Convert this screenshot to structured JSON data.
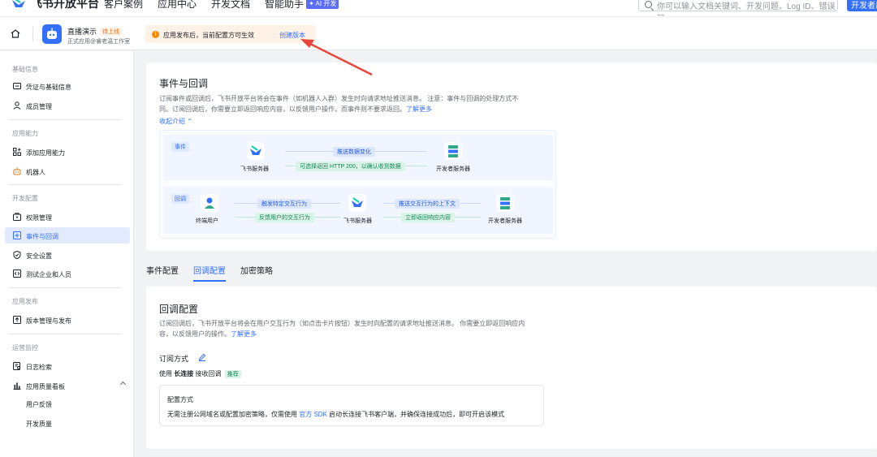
{
  "topnav": {
    "brand": "飞书开放平台",
    "items": [
      "客户案例",
      "应用中心",
      "开发文档",
      "智能助手"
    ],
    "ai_badge": "✦ AI 开发",
    "search_placeholder": "你可以输入文档关键词、开发问题、Log ID、错误码",
    "dev_button": "开发者后台"
  },
  "app": {
    "name": "直播演示",
    "status_tag": "待上线",
    "subtitle": "正式应用@睿老温工作室"
  },
  "notice": {
    "text": "应用发布后，当前配置方可生效",
    "link": "创建版本"
  },
  "sidebar": {
    "groups": [
      {
        "title": "基础信息",
        "items": [
          "凭证与基础信息",
          "成员管理"
        ]
      },
      {
        "title": "应用能力",
        "items": [
          "添加应用能力",
          "机器人"
        ]
      },
      {
        "title": "开发配置",
        "items": [
          "权限管理",
          "事件与回调",
          "安全设置",
          "测试企业和人员"
        ]
      },
      {
        "title": "应用发布",
        "items": [
          "版本管理与发布"
        ]
      },
      {
        "title": "运营监控",
        "items": [
          "日志检索",
          "应用质量看板"
        ]
      }
    ],
    "subitems": [
      "用户反馈",
      "开发质量"
    ],
    "active": "事件与回调"
  },
  "events": {
    "title": "事件与回调",
    "desc_line1": "订阅事件或回调后，飞书开放平台将会在事件（如机器人入群）发生时向请求地址推送消息。 注意：事件与回调的处理方式不",
    "desc_line2": "同。订阅回调后，你需要立即返回响应内容，以反馈用户操作，而事件则不要求返回。",
    "learn_more": "了解更多",
    "collapse": "收起介绍 ⌃",
    "diagram": {
      "event_tag": "事件",
      "callback_tag": "回调",
      "feishu_server": "飞书服务器",
      "dev_server": "开发者服务器",
      "end_user": "终端用户",
      "event_push": "推送数据变化",
      "event_return": "可选择返回 HTTP 200，以确认收到数据",
      "trigger": "触发特定交互行为",
      "feedback": "反馈用户的交互行为",
      "push_context": "推送交互行为的上下文",
      "return_now": "立即返回响应内容"
    }
  },
  "tabs": [
    "事件配置",
    "回调配置",
    "加密策略"
  ],
  "active_tab": "回调配置",
  "callback": {
    "title": "回调配置",
    "desc_line1": "订阅回调后，飞书开放平台将会在用户交互行为（如点击卡片按钮）发生时向配置的请求地址推送消息。 你需要立即返回响应内",
    "desc_line2": "容，以反馈用户的操作。",
    "learn_more": "了解更多",
    "sub_method": "订阅方式",
    "use_prefix": "使用",
    "use_mode": "长连接",
    "use_suffix": "接收回调",
    "recommend": "推荐",
    "cfg_title": "配置方式",
    "cfg_desc_pre": "无需注册公网域名或配置加密策略，仅需使用",
    "cfg_sdk": "官方 SDK",
    "cfg_desc_post": "启动长连接飞书客户端，并确保连接成功后，即可开启该模式"
  },
  "colors": {
    "primary": "#3370ff",
    "callout_arrow": "#e8453c",
    "warning": "#ff8800",
    "success": "#15845a"
  }
}
